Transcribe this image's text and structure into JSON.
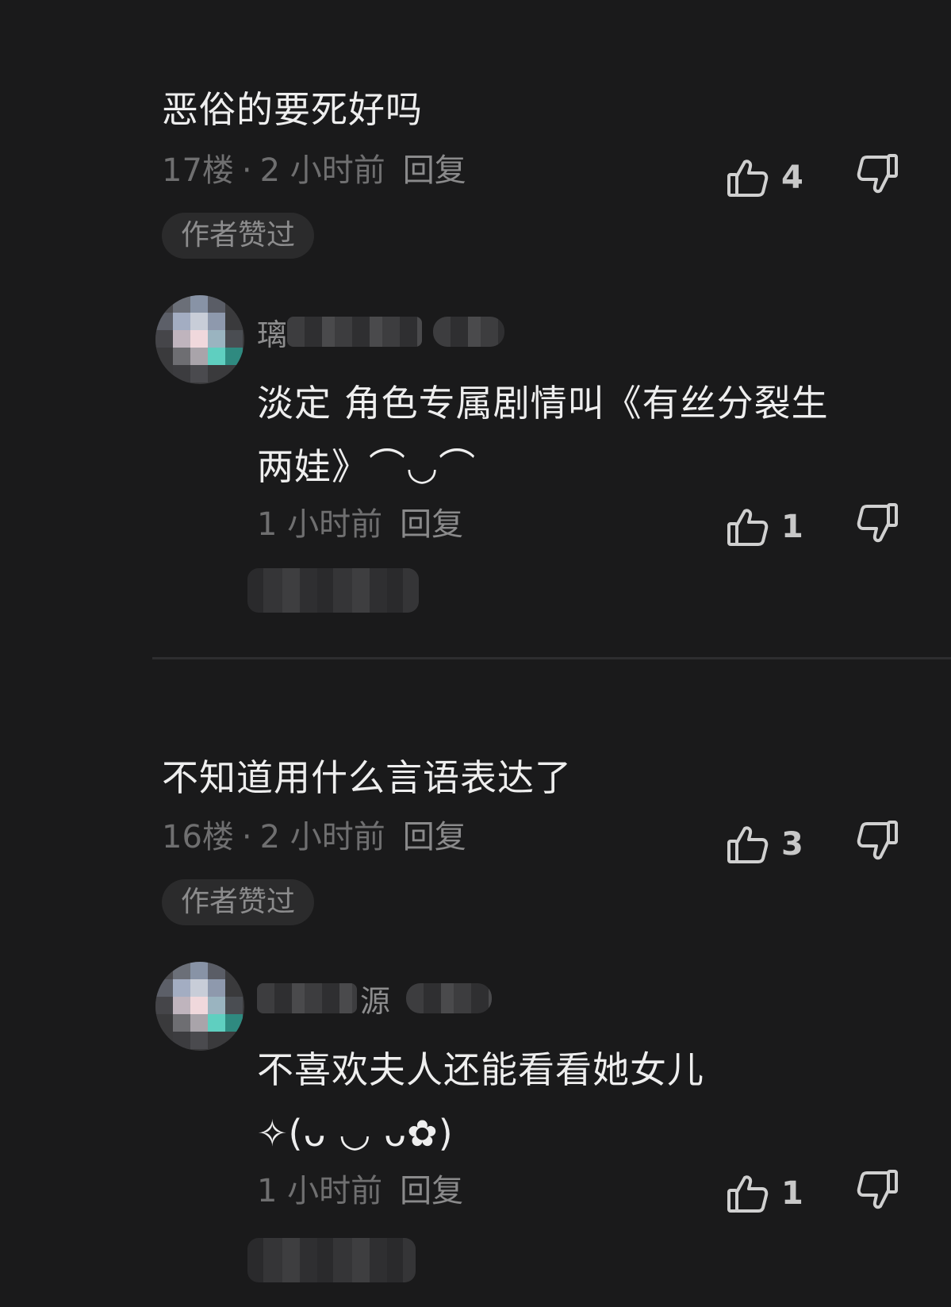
{
  "comments": [
    {
      "text": "恶俗的要死好吗",
      "floor": "17楼",
      "time": "2 小时前",
      "reply_label": "回复",
      "like_count": "4",
      "badge": "作者赞过",
      "reply": {
        "username_visible": "璃",
        "text_line1": "淡定 角色专属剧情叫《有丝分裂生",
        "text_line2": "两娃》⌒◡⌒",
        "time": "1 小时前",
        "reply_label": "回复",
        "like_count": "1"
      }
    },
    {
      "text": "不知道用什么言语表达了",
      "floor": "16楼",
      "time": "2 小时前",
      "reply_label": "回复",
      "like_count": "3",
      "badge": "作者赞过",
      "reply": {
        "username_visible": "源",
        "text_line1": "不喜欢夫人还能看看她女儿",
        "text_line2": "✧(ᴗ ◡ ᴗ✿)",
        "time": "1 小时前",
        "reply_label": "回复",
        "like_count": "1"
      }
    }
  ],
  "meta_separator": "·",
  "icons": {
    "like": "thumbs-up-icon",
    "dislike": "thumbs-down-icon"
  },
  "colors": {
    "background": "#1a1a1b",
    "text_primary": "#eeeeee",
    "text_secondary": "#6f6f70",
    "badge_bg": "#2b2b2c"
  }
}
